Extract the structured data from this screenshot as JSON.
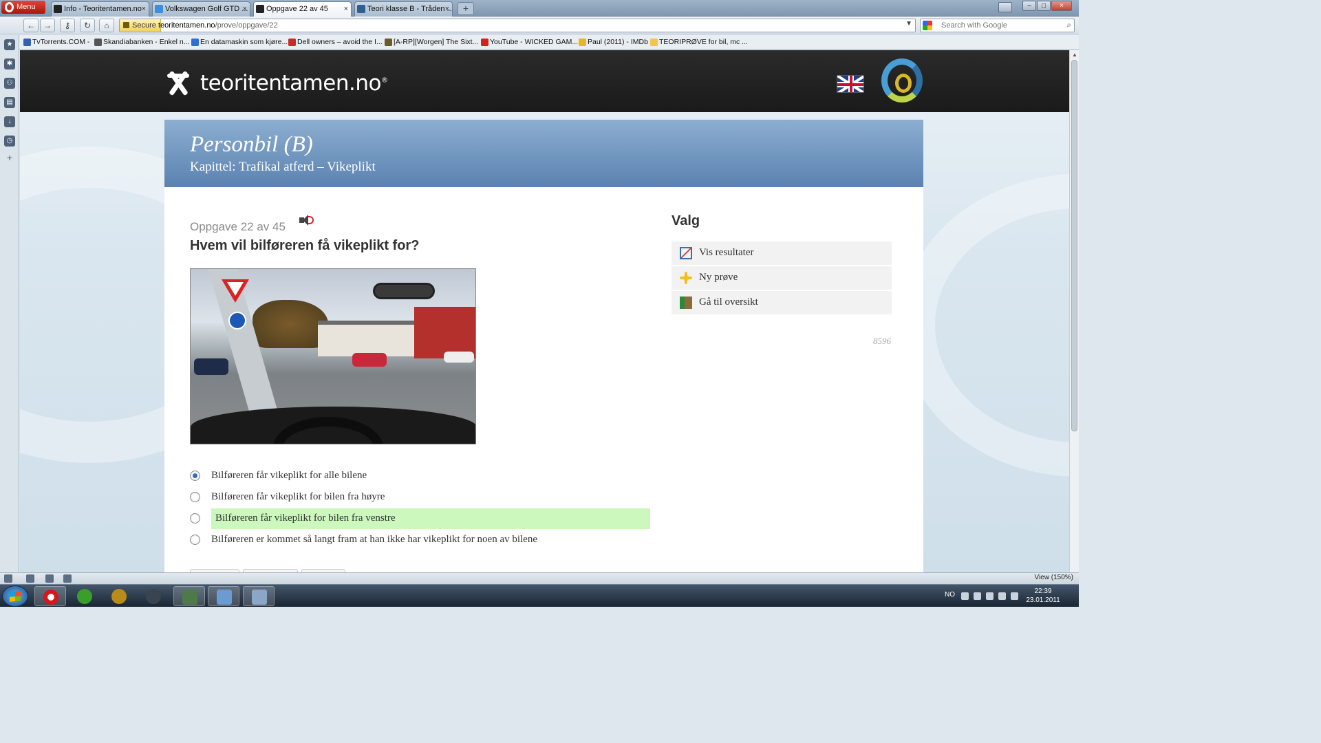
{
  "browser": {
    "menu_label": "Menu",
    "tabs": [
      {
        "title": "Info - Teoritentamen.no",
        "active": false
      },
      {
        "title": "Volkswagen Golf GTD ...",
        "active": false
      },
      {
        "title": "Oppgave 22 av 45",
        "active": true
      },
      {
        "title": "Teori klasse B - Tråden ...",
        "active": false
      }
    ],
    "close_glyph": "×",
    "newtab_glyph": "+",
    "address": {
      "secure_label": "Secure",
      "host": "teoritentamen.no",
      "path": "/prove/oppgave/22"
    },
    "search": {
      "placeholder": "Search with Google"
    },
    "bookmarks": [
      "TvTorrents.COM -",
      "Skandiabanken - Enkel n...",
      "En datamaskin som kjøre...",
      "Dell owners – avoid the I...",
      "[A-RP][Worgen] The Sixt...",
      "YouTube - WICKED GAM...",
      "Paul (2011) - IMDb",
      "TEORIPRØVE for bil, mc ..."
    ],
    "zoom_label": "View (150%)"
  },
  "site": {
    "logo_text": "teoritentamen.no",
    "logo_reg": "®",
    "banner": {
      "title": "Personbil (B)",
      "chapter": "Kapittel: Trafikal atferd – Vikeplikt"
    },
    "question": {
      "counter": "Oppgave 22 av 45",
      "text": "Hvem vil bilføreren få vikeplikt for?",
      "answers": [
        {
          "label": "Bilføreren får vikeplikt for alle bilene",
          "checked": true,
          "highlighted": false
        },
        {
          "label": "Bilføreren får vikeplikt for bilen fra høyre",
          "checked": false,
          "highlighted": false
        },
        {
          "label": "Bilføreren får vikeplikt for bilen fra venstre",
          "checked": false,
          "highlighted": true
        },
        {
          "label": "Bilføreren er kommet så langt fram at han ikke har vikeplikt for noen av bilene",
          "checked": false,
          "highlighted": false
        }
      ]
    },
    "valg": {
      "heading": "Valg",
      "items": [
        {
          "label": "Vis resultater",
          "icon": "results-chart-icon"
        },
        {
          "label": "Ny prøve",
          "icon": "new-test-star-icon"
        },
        {
          "label": "Gå til oversikt",
          "icon": "overview-exit-icon"
        }
      ],
      "code": "8596"
    },
    "colors": {
      "header_bg": "#1f1f1f",
      "banner_blue": "#6a8fba",
      "highlight_green": "#ccf7bd"
    }
  },
  "taskbar": {
    "lang": "NO",
    "time": "22:39",
    "date": "23.01.2011"
  }
}
